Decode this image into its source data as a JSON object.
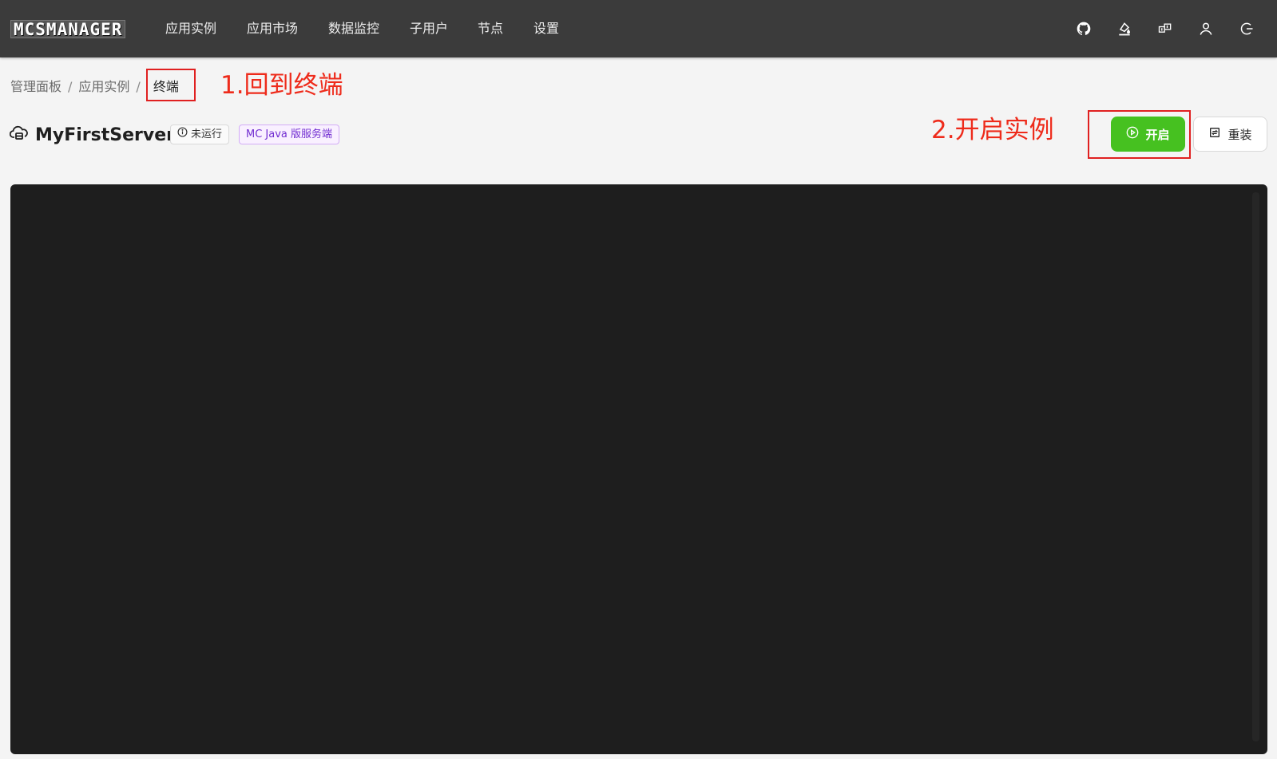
{
  "topbar": {
    "logo": "MCSMANAGER",
    "nav": [
      "应用实例",
      "应用市场",
      "数据监控",
      "子用户",
      "节点",
      "设置"
    ],
    "icons": [
      "github-icon",
      "theme-paint-icon",
      "language-icon",
      "user-icon",
      "logout-icon"
    ]
  },
  "breadcrumb": {
    "items": [
      "管理面板",
      "应用实例"
    ],
    "separator": "/",
    "current": "终端"
  },
  "annotations": {
    "step1": "1.回到终端",
    "step2": "2.开启实例",
    "color": "#e02020"
  },
  "instance": {
    "name": "MyFirstServer",
    "status": "未运行",
    "type": "MC Java 版服务端"
  },
  "buttons": {
    "start": "开启",
    "reinstall": "重装"
  },
  "colors": {
    "topbar": "#3b3b3b",
    "start_button": "#46c120",
    "terminal": "#1e1e1e",
    "type_tag": "#722ed1"
  }
}
